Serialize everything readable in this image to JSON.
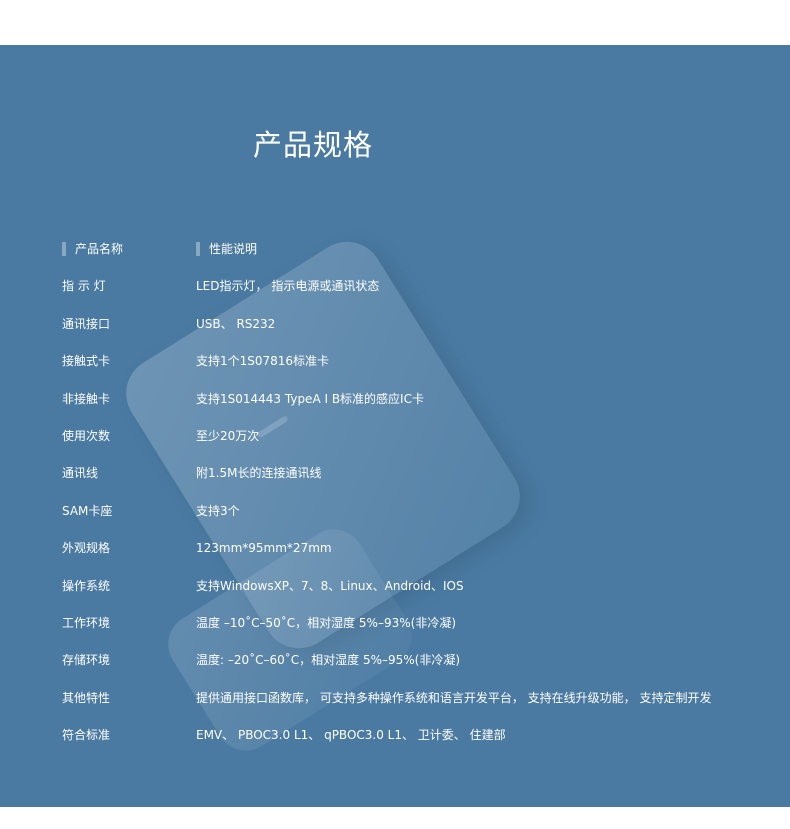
{
  "page": {
    "title": "产品规格"
  },
  "spec_table": {
    "headers": {
      "label": "产品名称",
      "value": "性能说明"
    },
    "rows": [
      {
        "label": "指 示 灯",
        "value": "LED指示灯， 指示电源或通讯状态"
      },
      {
        "label": "通讯接口",
        "value": "USB、 RS232"
      },
      {
        "label": "接触式卡",
        "value": "支持1个1S07816标准卡"
      },
      {
        "label": "非接触卡",
        "value": "支持1S014443 TypeA I B标准的感应IC卡"
      },
      {
        "label": "使用次数",
        "value": "至少20万次"
      },
      {
        "label": "通讯线",
        "value": "附1.5M长的连接通讯线"
      },
      {
        "label": "SAM卡座",
        "value": "支持3个"
      },
      {
        "label": "外观规格",
        "value": "123mm*95mm*27mm"
      },
      {
        "label": "操作系统",
        "value": "支持WindowsXP、7、8、Linux、Android、IOS"
      },
      {
        "label": "工作环境",
        "value": "温度 –10˚C–50˚C，相对湿度 5%–93%(非冷凝)"
      },
      {
        "label": "存储环境",
        "value": "温度: –20˚C–60˚C，相对湿度 5%–95%(非冷凝)"
      },
      {
        "label": "其他特性",
        "value": "提供通用接口函数库， 可支持多种操作系统和语言开发平台， 支持在线升级功能， 支持定制开发"
      },
      {
        "label": "符合标准",
        "value": "EMV、 PBOC3.0 L1、 qPBOC3.0 L1、 卫计委、 住建部"
      }
    ]
  },
  "colors": {
    "panel_background": "#4a7aa2",
    "text": "#ffffff"
  }
}
